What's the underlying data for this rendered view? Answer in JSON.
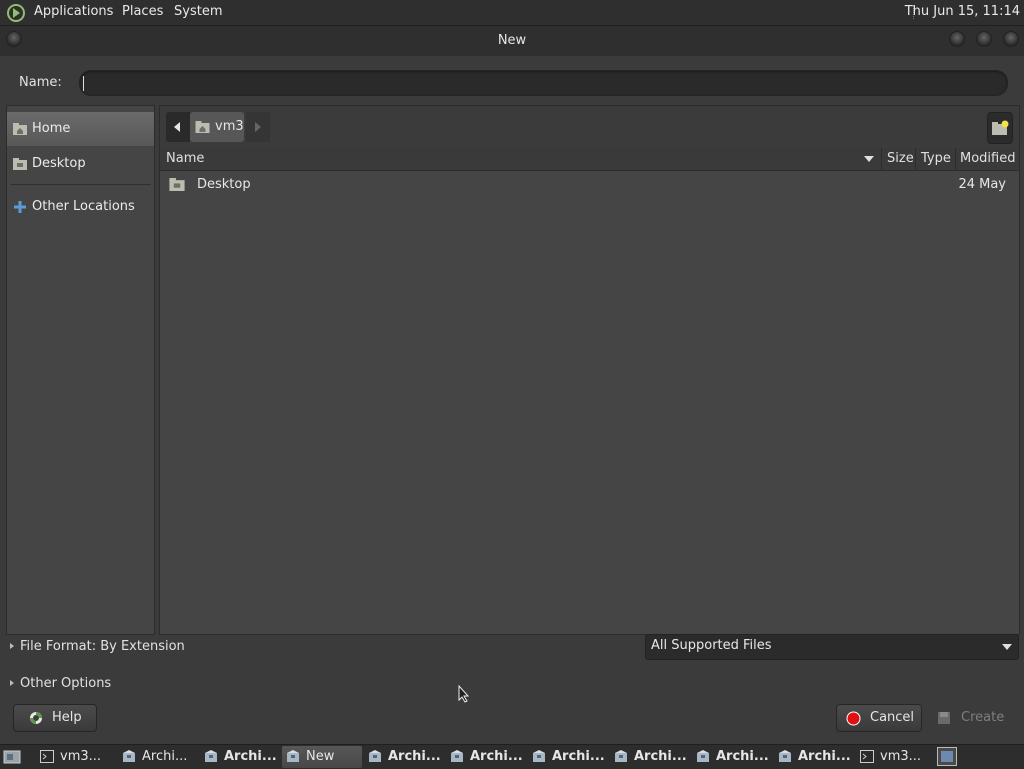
{
  "top_panel": {
    "menus": [
      "Applications",
      "Places",
      "System"
    ],
    "clock": "Thu Jun 15, 11:14"
  },
  "window": {
    "title": "New"
  },
  "name_field": {
    "label": "Name:",
    "value": ""
  },
  "sidebar": {
    "items": [
      {
        "label": "Home",
        "icon": "home-folder-icon",
        "active": true
      },
      {
        "label": "Desktop",
        "icon": "desktop-folder-icon",
        "active": false
      },
      {
        "label": "Other Locations",
        "icon": "plus-icon",
        "active": false
      }
    ]
  },
  "pathbar": {
    "crumb": "vm3"
  },
  "file_list": {
    "columns": [
      "Name",
      "Size",
      "Type",
      "Modified"
    ],
    "rows": [
      {
        "name": "Desktop",
        "size": "",
        "type": "",
        "modified": "24 May"
      }
    ]
  },
  "file_format": {
    "label": "File Format: By Extension"
  },
  "filter": {
    "selected": "All Supported Files"
  },
  "other_options": {
    "label": "Other Options"
  },
  "buttons": {
    "help": "Help",
    "cancel": "Cancel",
    "create": "Create"
  },
  "taskbar": {
    "tasks": [
      {
        "label": "vm3...",
        "icon": "terminal-icon",
        "bold": false,
        "active": false
      },
      {
        "label": "Archi...",
        "icon": "archive-icon",
        "bold": false,
        "active": false
      },
      {
        "label": "Archi...",
        "icon": "archive-icon",
        "bold": true,
        "active": false
      },
      {
        "label": "New",
        "icon": "archive-icon",
        "bold": false,
        "active": true
      },
      {
        "label": "Archi...",
        "icon": "archive-icon",
        "bold": true,
        "active": false
      },
      {
        "label": "Archi...",
        "icon": "archive-icon",
        "bold": true,
        "active": false
      },
      {
        "label": "Archi...",
        "icon": "archive-icon",
        "bold": true,
        "active": false
      },
      {
        "label": "Archi...",
        "icon": "archive-icon",
        "bold": true,
        "active": false
      },
      {
        "label": "Archi...",
        "icon": "archive-icon",
        "bold": true,
        "active": false
      },
      {
        "label": "Archi...",
        "icon": "archive-icon",
        "bold": true,
        "active": false
      },
      {
        "label": "vm3...",
        "icon": "terminal-icon",
        "bold": false,
        "active": false
      }
    ]
  },
  "colors": {
    "accent": "#7fa86a",
    "cancel_red": "#e01010"
  }
}
